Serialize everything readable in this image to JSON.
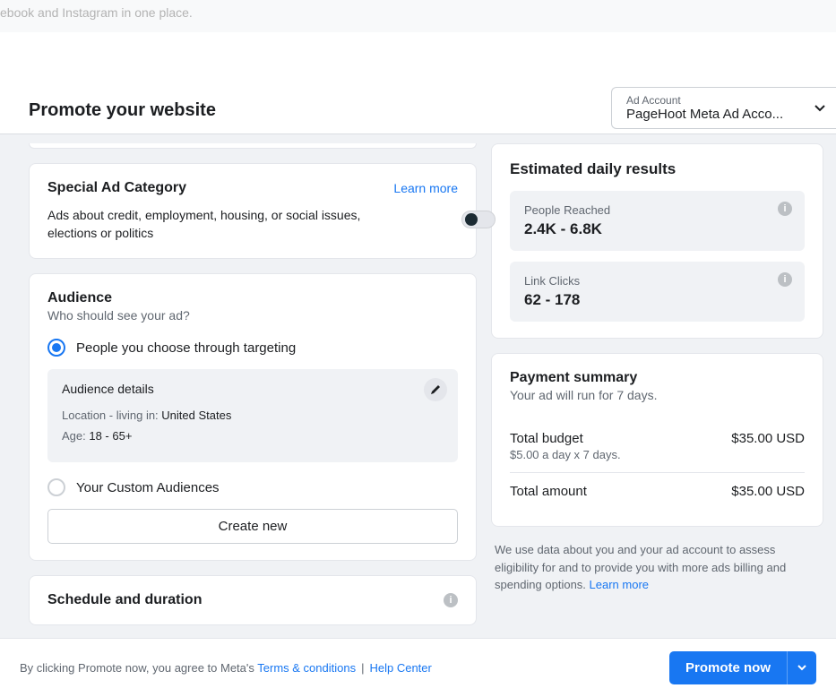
{
  "top_banner": "ebook and Instagram in one place.",
  "header": {
    "title": "Promote your website",
    "account_label": "Ad Account",
    "account_value": "PageHoot Meta Ad Acco..."
  },
  "special_ad": {
    "title": "Special Ad Category",
    "learn_more": "Learn more",
    "description": "Ads about credit, employment, housing, or social issues, elections or politics"
  },
  "audience": {
    "title": "Audience",
    "subtitle": "Who should see your ad?",
    "option_targeting": "People you choose through targeting",
    "details_title": "Audience details",
    "location_label": "Location - living in: ",
    "location_value": "United States",
    "age_label": "Age: ",
    "age_value": "18 - 65+",
    "option_custom": "Your Custom Audiences",
    "create_new": "Create new"
  },
  "schedule": {
    "title": "Schedule and duration"
  },
  "estimated": {
    "title": "Estimated daily results",
    "reach_label": "People Reached",
    "reach_value": "2.4K - 6.8K",
    "clicks_label": "Link Clicks",
    "clicks_value": "62 - 178"
  },
  "payment": {
    "title": "Payment summary",
    "subtitle": "Your ad will run for 7 days.",
    "budget_label": "Total budget",
    "budget_sub": "$5.00 a day x 7 days.",
    "budget_amount": "$35.00 USD",
    "total_label": "Total amount",
    "total_amount": "$35.00 USD"
  },
  "disclaimer": {
    "text": "We use data about you and your ad account to assess eligibility for and to provide you with more ads billing and spending options. ",
    "learn_more": "Learn more"
  },
  "footer": {
    "agree_prefix": "By clicking Promote now, you agree to Meta's ",
    "terms": "Terms & conditions",
    "help": "Help Center",
    "promote_btn": "Promote now"
  }
}
